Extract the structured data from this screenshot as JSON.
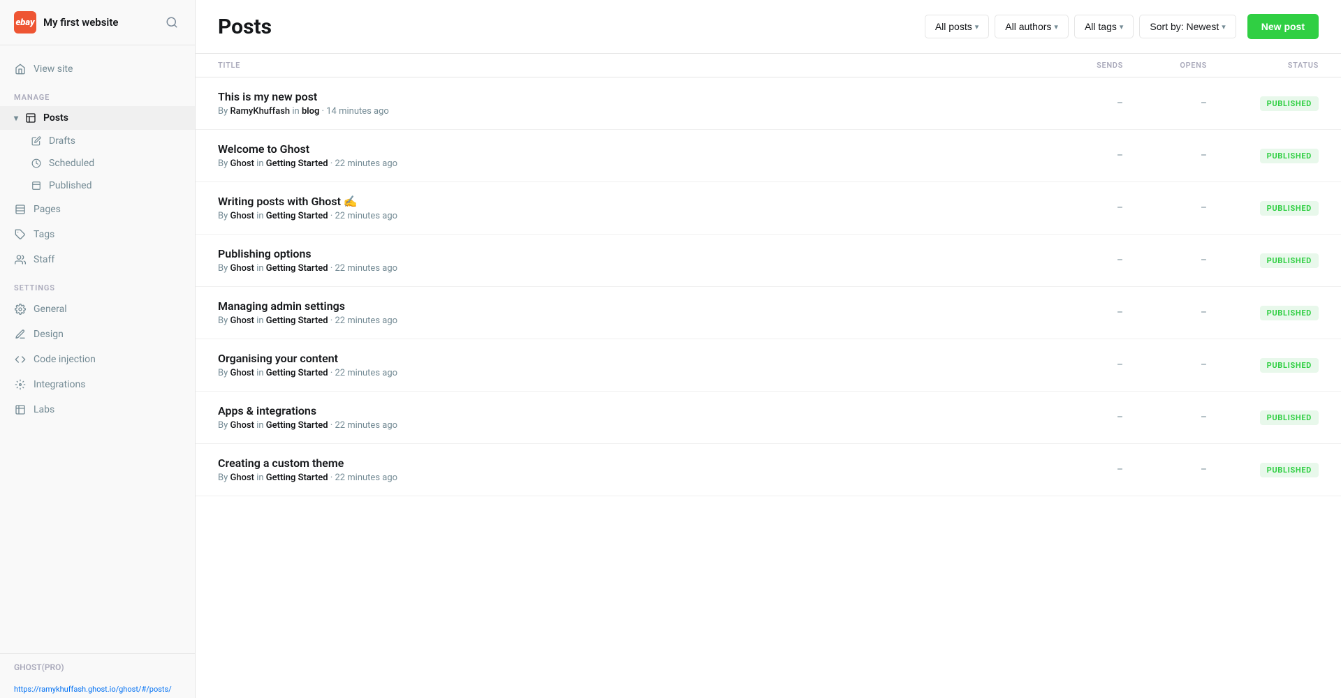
{
  "brand": {
    "logo_text": "ebay",
    "site_name": "My first website"
  },
  "sidebar": {
    "manage_label": "MANAGE",
    "settings_label": "SETTINGS",
    "footer_label": "GHOST(PRO)",
    "status_url": "https://ramykhuffash.ghost.io/ghost/#/posts/",
    "view_site": "View site",
    "posts": "Posts",
    "drafts": "Drafts",
    "scheduled": "Scheduled",
    "published": "Published",
    "pages": "Pages",
    "tags": "Tags",
    "staff": "Staff",
    "general": "General",
    "design": "Design",
    "code_injection": "Code injection",
    "integrations": "Integrations",
    "labs": "Labs"
  },
  "header": {
    "title": "Posts",
    "filters": {
      "all_posts": "All posts",
      "all_authors": "All authors",
      "all_tags": "All tags",
      "sort": "Sort by: Newest"
    },
    "new_post_btn": "New post"
  },
  "table": {
    "columns": {
      "title": "TITLE",
      "sends": "SENDS",
      "opens": "OPENS",
      "status": "STATUS"
    },
    "posts": [
      {
        "title": "This is my new post",
        "author": "RamyKhuffash",
        "tag": "blog",
        "time": "14 minutes ago",
        "status": "PUBLISHED"
      },
      {
        "title": "Welcome to Ghost",
        "author": "Ghost",
        "tag": "Getting Started",
        "time": "22 minutes ago",
        "status": "PUBLISHED"
      },
      {
        "title": "Writing posts with Ghost ✍",
        "author": "Ghost",
        "tag": "Getting Started",
        "time": "22 minutes ago",
        "status": "PUBLISHED"
      },
      {
        "title": "Publishing options",
        "author": "Ghost",
        "tag": "Getting Started",
        "time": "22 minutes ago",
        "status": "PUBLISHED"
      },
      {
        "title": "Managing admin settings",
        "author": "Ghost",
        "tag": "Getting Started",
        "time": "22 minutes ago",
        "status": "PUBLISHED"
      },
      {
        "title": "Organising your content",
        "author": "Ghost",
        "tag": "Getting Started",
        "time": "22 minutes ago",
        "status": "PUBLISHED"
      },
      {
        "title": "Apps & integrations",
        "author": "Ghost",
        "tag": "Getting Started",
        "time": "22 minutes ago",
        "status": "PUBLISHED"
      },
      {
        "title": "Creating a custom theme",
        "author": "Ghost",
        "tag": "Getting Started",
        "time": "22 minutes ago",
        "status": "PUBLISHED"
      }
    ]
  }
}
